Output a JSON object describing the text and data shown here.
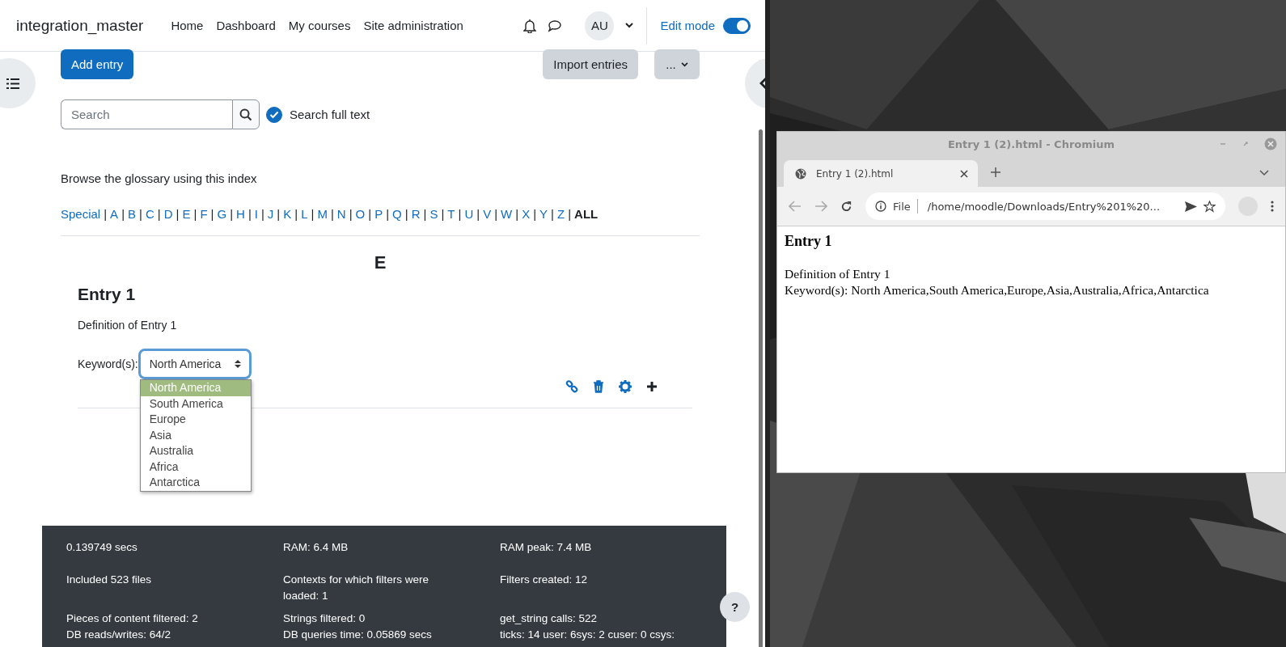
{
  "header": {
    "site_name": "integration_master",
    "nav": [
      "Home",
      "Dashboard",
      "My courses",
      "Site administration"
    ],
    "avatar": "AU",
    "edit_mode": {
      "label": "Edit mode",
      "on": true
    }
  },
  "actions": {
    "add": "Add entry",
    "import": "Import entries",
    "more": "..."
  },
  "search": {
    "placeholder": "Search",
    "full_text": {
      "label": "Search full text",
      "checked": true
    }
  },
  "browse_label": "Browse the glossary using this index",
  "index": {
    "separator": "|",
    "items": [
      {
        "label": "Special",
        "selected": false
      },
      {
        "label": "A",
        "selected": false
      },
      {
        "label": "B",
        "selected": false
      },
      {
        "label": "C",
        "selected": false
      },
      {
        "label": "D",
        "selected": false
      },
      {
        "label": "E",
        "selected": false
      },
      {
        "label": "F",
        "selected": false
      },
      {
        "label": "G",
        "selected": false
      },
      {
        "label": "H",
        "selected": false
      },
      {
        "label": "I",
        "selected": false
      },
      {
        "label": "J",
        "selected": false
      },
      {
        "label": "K",
        "selected": false
      },
      {
        "label": "L",
        "selected": false
      },
      {
        "label": "M",
        "selected": false
      },
      {
        "label": "N",
        "selected": false
      },
      {
        "label": "O",
        "selected": false
      },
      {
        "label": "P",
        "selected": false
      },
      {
        "label": "Q",
        "selected": false
      },
      {
        "label": "R",
        "selected": false
      },
      {
        "label": "S",
        "selected": false
      },
      {
        "label": "T",
        "selected": false
      },
      {
        "label": "U",
        "selected": false
      },
      {
        "label": "V",
        "selected": false
      },
      {
        "label": "W",
        "selected": false
      },
      {
        "label": "X",
        "selected": false
      },
      {
        "label": "Y",
        "selected": false
      },
      {
        "label": "Z",
        "selected": false
      },
      {
        "label": "ALL",
        "selected": true
      }
    ]
  },
  "letter": "E",
  "entry": {
    "title": "Entry 1",
    "definition": "Definition of Entry 1",
    "keyword_label": "Keyword(s):",
    "select": {
      "value": "North America",
      "options": [
        {
          "label": "North America",
          "selected": true
        },
        {
          "label": "South America",
          "selected": false
        },
        {
          "label": "Europe",
          "selected": false
        },
        {
          "label": "Asia",
          "selected": false
        },
        {
          "label": "Australia",
          "selected": false
        },
        {
          "label": "Africa",
          "selected": false
        },
        {
          "label": "Antarctica",
          "selected": false
        }
      ]
    }
  },
  "footer_stats": [
    "0.139749 secs",
    "RAM: 6.4 MB",
    "RAM peak: 7.4 MB",
    "Included 523 files",
    "Contexts for which filters were loaded: 1",
    "Filters created: 12",
    "Pieces of content filtered: 2",
    "Strings filtered: 0",
    "get_string calls: 522",
    "DB reads/writes: 64/2",
    "DB queries time: 0.05869 secs",
    "ticks: 14 user: 6sys: 2 cuser: 0 csys:"
  ],
  "help": "?",
  "browser": {
    "title": "Entry 1 (2).html - Chromium",
    "tab": "Entry 1 (2).html",
    "address": {
      "scheme": "File",
      "url": "/home/moodle/Downloads/Entry%201%20..."
    },
    "page": {
      "heading": "Entry 1",
      "definition": "Definition of Entry 1",
      "keywords": "Keyword(s): North America,South America,Europe,Asia,Australia,Africa,Antarctica"
    }
  }
}
